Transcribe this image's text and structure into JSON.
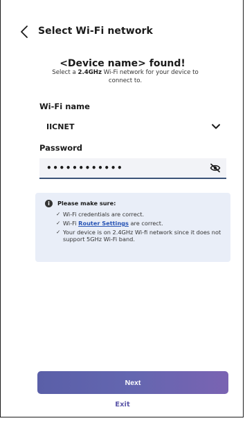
{
  "header": {
    "title": "Select Wi-Fi network",
    "back_icon": "chevron-left-icon"
  },
  "found": {
    "title": "<Device name> found!",
    "sub_prefix": "Select a ",
    "sub_bold": "2.4GHz",
    "sub_suffix": " Wi-Fi network for your device to connect to."
  },
  "wifi": {
    "label": "Wi-Fi name",
    "value": "IICNET",
    "dropdown_icon": "chevron-down-icon"
  },
  "password": {
    "label": "Password",
    "value": "••••••••••••",
    "toggle_icon": "eye-off-icon"
  },
  "info": {
    "icon": "info-icon",
    "title": "Please make sure:",
    "items": [
      {
        "text": "Wi-Fi credentials are correct."
      },
      {
        "pre": "Wi-Fi ",
        "link": "Router Settings",
        "post": " are correct."
      },
      {
        "text": "Your device is on 2.4GHz Wi-fi network since it does not support 5GHz Wi-Fi band."
      }
    ],
    "check": "✓"
  },
  "actions": {
    "next_label": "Next",
    "exit_label": "Exit"
  },
  "colors": {
    "accent": "#6466b0",
    "link": "#2754b5",
    "info_bg": "#e9eef8",
    "field_underline": "#3b5378"
  }
}
